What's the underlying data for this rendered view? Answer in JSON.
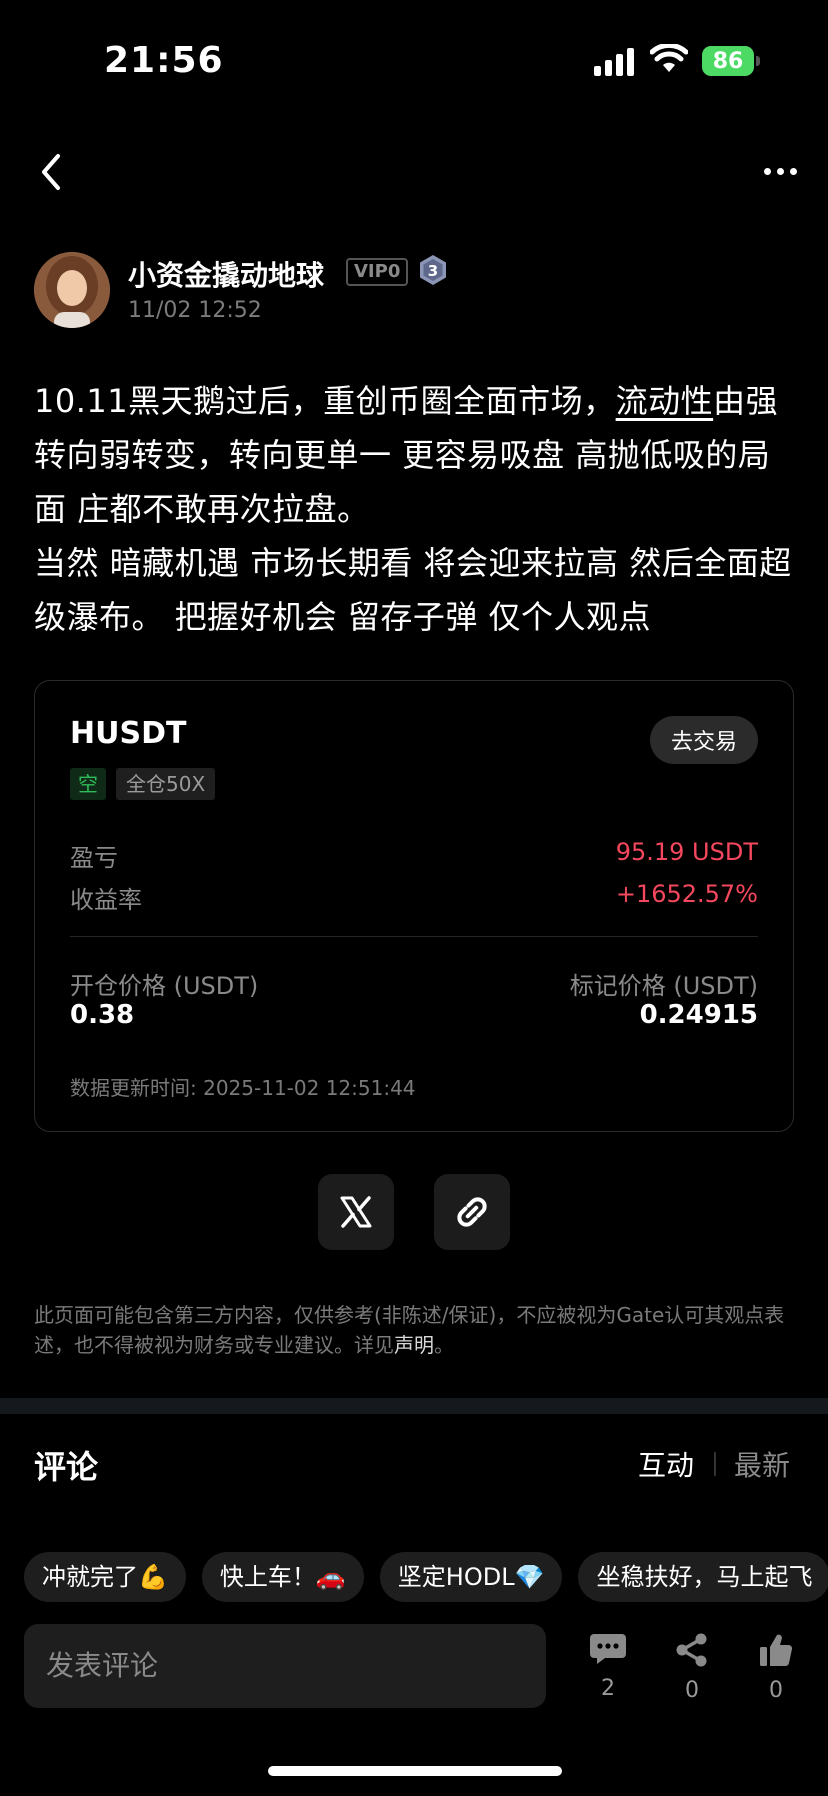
{
  "status_bar": {
    "time": "21:56",
    "battery": "86"
  },
  "post": {
    "author": "小资金撬动地球",
    "vip": "VIP0",
    "level": "3",
    "time": "11/02 12:52",
    "text_part1": "10.11黑天鹅过后，重创币圈全面市场，",
    "text_link": "流动性",
    "text_part2": "由强转向弱转变，转向更单一 更容易吸盘 高抛低吸的局面 庄都不敢再次拉盘。",
    "text_part3": "当然 暗藏机遇 市场长期看 将会迎来拉高 然后全面超级瀑布。 把握好机会 留存子弹 仅个人观点"
  },
  "card": {
    "symbol": "HUSDT",
    "trade_button": "去交易",
    "side_tag": "空",
    "leverage_tag": "全仓50X",
    "pnl_label": "盈亏",
    "pnl_value": "95.19 USDT",
    "roi_label": "收益率",
    "roi_value": "+1652.57%",
    "open_label": "开仓价格 (USDT)",
    "open_value": "0.38",
    "mark_label": "标记价格 (USDT)",
    "mark_value": "0.24915",
    "update_label": "数据更新时间:",
    "update_time": "2025-11-02 12:51:44"
  },
  "share": {
    "x_icon": "x-logo-icon",
    "link_icon": "link-icon"
  },
  "disclaimer": {
    "text": "此页面可能包含第三方内容，仅供参考(非陈述/保证)，不应被视为Gate认可其观点表述，也不得被视为财务或专业建议。详见",
    "link": "声明",
    "end": "。"
  },
  "comments": {
    "title": "评论",
    "sort_active": "互动",
    "sort_latest": "最新",
    "chips": [
      "冲就完了💪",
      "快上车！🚗",
      "坚定HODL💎",
      "坐稳扶好，马上起飞"
    ],
    "input_placeholder": "发表评论",
    "comment_count": "2",
    "share_count": "0",
    "like_count": "0"
  },
  "colors": {
    "negative": "#f5475d",
    "short_tag": "#2fbd5a",
    "battery": "#4cd964"
  }
}
